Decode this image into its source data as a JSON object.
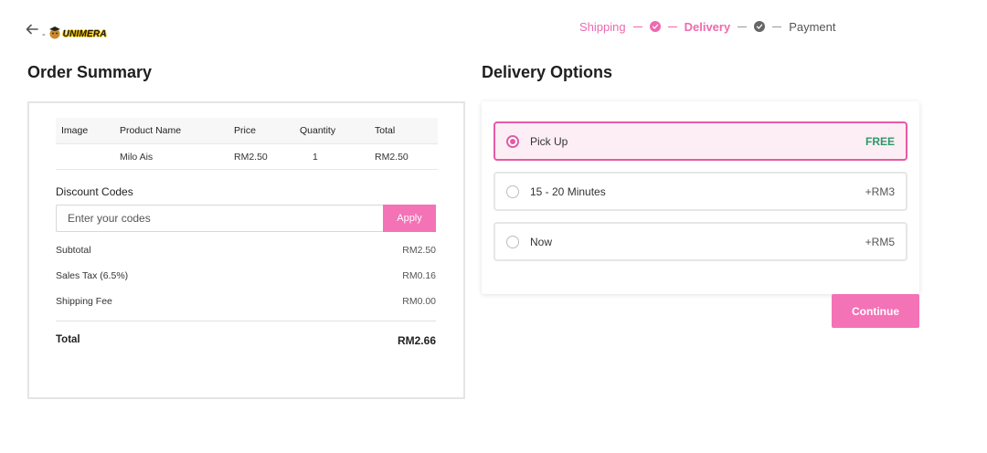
{
  "header": {
    "logo_separator": "-",
    "logo_text": "UNIMERA",
    "steps": [
      {
        "label": "Shipping",
        "status": "done"
      },
      {
        "label": "Delivery",
        "status": "current"
      },
      {
        "label": "Payment",
        "status": "upcoming"
      }
    ]
  },
  "order_summary": {
    "title": "Order Summary",
    "table": {
      "headers": [
        "Image",
        "Product Name",
        "Price",
        "Quantity",
        "Total"
      ],
      "rows": [
        {
          "image": "",
          "product": "Milo Ais",
          "price": "RM2.50",
          "quantity": "1",
          "total": "RM2.50"
        }
      ]
    },
    "discount": {
      "label": "Discount Codes",
      "placeholder": "Enter your codes",
      "value": "",
      "apply_label": "Apply"
    },
    "subtotal": {
      "label": "Subtotal",
      "value": "RM2.50"
    },
    "tax": {
      "label": "Sales Tax (6.5%)",
      "value": "RM0.16"
    },
    "shipping": {
      "label": "Shipping Fee",
      "value": "RM0.00"
    },
    "total": {
      "label": "Total",
      "value": "RM2.66"
    }
  },
  "delivery": {
    "title": "Delivery Options",
    "options": [
      {
        "label": "Pick Up",
        "price": "FREE",
        "selected": true
      },
      {
        "label": "15 - 20 Minutes",
        "price": "+RM3",
        "selected": false
      },
      {
        "label": "Now",
        "price": "+RM5",
        "selected": false
      }
    ],
    "continue_label": "Continue"
  },
  "colors": {
    "accent": "#f472b6",
    "accent_dark": "#e55aa5",
    "free": "#2a9a6a"
  }
}
